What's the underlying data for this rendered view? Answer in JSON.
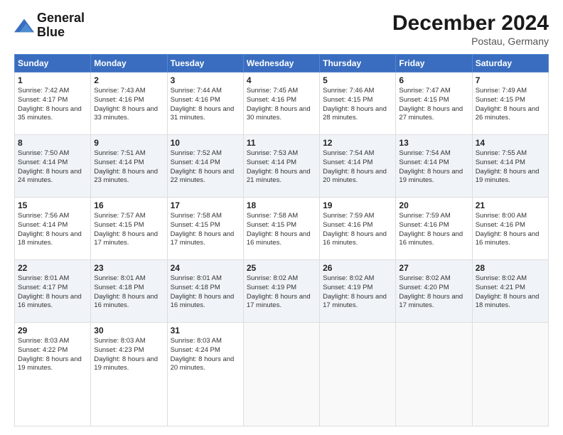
{
  "header": {
    "logo_line1": "General",
    "logo_line2": "Blue",
    "title": "December 2024",
    "subtitle": "Postau, Germany"
  },
  "days_of_week": [
    "Sunday",
    "Monday",
    "Tuesday",
    "Wednesday",
    "Thursday",
    "Friday",
    "Saturday"
  ],
  "weeks": [
    [
      {
        "day": "1",
        "sunrise": "Sunrise: 7:42 AM",
        "sunset": "Sunset: 4:17 PM",
        "daylight": "Daylight: 8 hours and 35 minutes."
      },
      {
        "day": "2",
        "sunrise": "Sunrise: 7:43 AM",
        "sunset": "Sunset: 4:16 PM",
        "daylight": "Daylight: 8 hours and 33 minutes."
      },
      {
        "day": "3",
        "sunrise": "Sunrise: 7:44 AM",
        "sunset": "Sunset: 4:16 PM",
        "daylight": "Daylight: 8 hours and 31 minutes."
      },
      {
        "day": "4",
        "sunrise": "Sunrise: 7:45 AM",
        "sunset": "Sunset: 4:16 PM",
        "daylight": "Daylight: 8 hours and 30 minutes."
      },
      {
        "day": "5",
        "sunrise": "Sunrise: 7:46 AM",
        "sunset": "Sunset: 4:15 PM",
        "daylight": "Daylight: 8 hours and 28 minutes."
      },
      {
        "day": "6",
        "sunrise": "Sunrise: 7:47 AM",
        "sunset": "Sunset: 4:15 PM",
        "daylight": "Daylight: 8 hours and 27 minutes."
      },
      {
        "day": "7",
        "sunrise": "Sunrise: 7:49 AM",
        "sunset": "Sunset: 4:15 PM",
        "daylight": "Daylight: 8 hours and 26 minutes."
      }
    ],
    [
      {
        "day": "8",
        "sunrise": "Sunrise: 7:50 AM",
        "sunset": "Sunset: 4:14 PM",
        "daylight": "Daylight: 8 hours and 24 minutes."
      },
      {
        "day": "9",
        "sunrise": "Sunrise: 7:51 AM",
        "sunset": "Sunset: 4:14 PM",
        "daylight": "Daylight: 8 hours and 23 minutes."
      },
      {
        "day": "10",
        "sunrise": "Sunrise: 7:52 AM",
        "sunset": "Sunset: 4:14 PM",
        "daylight": "Daylight: 8 hours and 22 minutes."
      },
      {
        "day": "11",
        "sunrise": "Sunrise: 7:53 AM",
        "sunset": "Sunset: 4:14 PM",
        "daylight": "Daylight: 8 hours and 21 minutes."
      },
      {
        "day": "12",
        "sunrise": "Sunrise: 7:54 AM",
        "sunset": "Sunset: 4:14 PM",
        "daylight": "Daylight: 8 hours and 20 minutes."
      },
      {
        "day": "13",
        "sunrise": "Sunrise: 7:54 AM",
        "sunset": "Sunset: 4:14 PM",
        "daylight": "Daylight: 8 hours and 19 minutes."
      },
      {
        "day": "14",
        "sunrise": "Sunrise: 7:55 AM",
        "sunset": "Sunset: 4:14 PM",
        "daylight": "Daylight: 8 hours and 19 minutes."
      }
    ],
    [
      {
        "day": "15",
        "sunrise": "Sunrise: 7:56 AM",
        "sunset": "Sunset: 4:14 PM",
        "daylight": "Daylight: 8 hours and 18 minutes."
      },
      {
        "day": "16",
        "sunrise": "Sunrise: 7:57 AM",
        "sunset": "Sunset: 4:15 PM",
        "daylight": "Daylight: 8 hours and 17 minutes."
      },
      {
        "day": "17",
        "sunrise": "Sunrise: 7:58 AM",
        "sunset": "Sunset: 4:15 PM",
        "daylight": "Daylight: 8 hours and 17 minutes."
      },
      {
        "day": "18",
        "sunrise": "Sunrise: 7:58 AM",
        "sunset": "Sunset: 4:15 PM",
        "daylight": "Daylight: 8 hours and 16 minutes."
      },
      {
        "day": "19",
        "sunrise": "Sunrise: 7:59 AM",
        "sunset": "Sunset: 4:16 PM",
        "daylight": "Daylight: 8 hours and 16 minutes."
      },
      {
        "day": "20",
        "sunrise": "Sunrise: 7:59 AM",
        "sunset": "Sunset: 4:16 PM",
        "daylight": "Daylight: 8 hours and 16 minutes."
      },
      {
        "day": "21",
        "sunrise": "Sunrise: 8:00 AM",
        "sunset": "Sunset: 4:16 PM",
        "daylight": "Daylight: 8 hours and 16 minutes."
      }
    ],
    [
      {
        "day": "22",
        "sunrise": "Sunrise: 8:01 AM",
        "sunset": "Sunset: 4:17 PM",
        "daylight": "Daylight: 8 hours and 16 minutes."
      },
      {
        "day": "23",
        "sunrise": "Sunrise: 8:01 AM",
        "sunset": "Sunset: 4:18 PM",
        "daylight": "Daylight: 8 hours and 16 minutes."
      },
      {
        "day": "24",
        "sunrise": "Sunrise: 8:01 AM",
        "sunset": "Sunset: 4:18 PM",
        "daylight": "Daylight: 8 hours and 16 minutes."
      },
      {
        "day": "25",
        "sunrise": "Sunrise: 8:02 AM",
        "sunset": "Sunset: 4:19 PM",
        "daylight": "Daylight: 8 hours and 17 minutes."
      },
      {
        "day": "26",
        "sunrise": "Sunrise: 8:02 AM",
        "sunset": "Sunset: 4:19 PM",
        "daylight": "Daylight: 8 hours and 17 minutes."
      },
      {
        "day": "27",
        "sunrise": "Sunrise: 8:02 AM",
        "sunset": "Sunset: 4:20 PM",
        "daylight": "Daylight: 8 hours and 17 minutes."
      },
      {
        "day": "28",
        "sunrise": "Sunrise: 8:02 AM",
        "sunset": "Sunset: 4:21 PM",
        "daylight": "Daylight: 8 hours and 18 minutes."
      }
    ],
    [
      {
        "day": "29",
        "sunrise": "Sunrise: 8:03 AM",
        "sunset": "Sunset: 4:22 PM",
        "daylight": "Daylight: 8 hours and 19 minutes."
      },
      {
        "day": "30",
        "sunrise": "Sunrise: 8:03 AM",
        "sunset": "Sunset: 4:23 PM",
        "daylight": "Daylight: 8 hours and 19 minutes."
      },
      {
        "day": "31",
        "sunrise": "Sunrise: 8:03 AM",
        "sunset": "Sunset: 4:24 PM",
        "daylight": "Daylight: 8 hours and 20 minutes."
      },
      null,
      null,
      null,
      null
    ]
  ]
}
